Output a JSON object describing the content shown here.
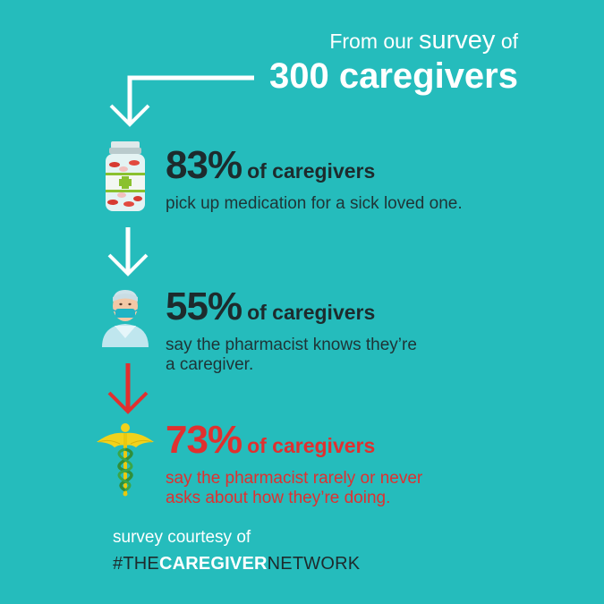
{
  "header": {
    "prefix": "From our",
    "survey_word": "survey",
    "suffix": "of",
    "headline": "300 caregivers"
  },
  "stats": [
    {
      "percent": "83%",
      "label": "of caregivers",
      "description": [
        "pick up medication for a sick loved one."
      ],
      "icon": "pill-bottle-icon"
    },
    {
      "percent": "55%",
      "label": "of caregivers",
      "description": [
        "say the pharmacist knows they’re",
        "a caregiver."
      ],
      "icon": "pharmacist-icon"
    },
    {
      "percent": "73%",
      "label": "of caregivers",
      "description": [
        "say the pharmacist rarely or never",
        "asks about how they’re doing."
      ],
      "icon": "caduceus-icon"
    }
  ],
  "footer": {
    "credit": "survey courtesy of",
    "network_prefix": "#THE",
    "network_bold": "CAREGIVER",
    "network_suffix": "NETWORK"
  },
  "colors": {
    "background": "#25bcbc",
    "dark_text": "#1d2b2d",
    "alert_red": "#e0302f",
    "white": "#ffffff"
  }
}
